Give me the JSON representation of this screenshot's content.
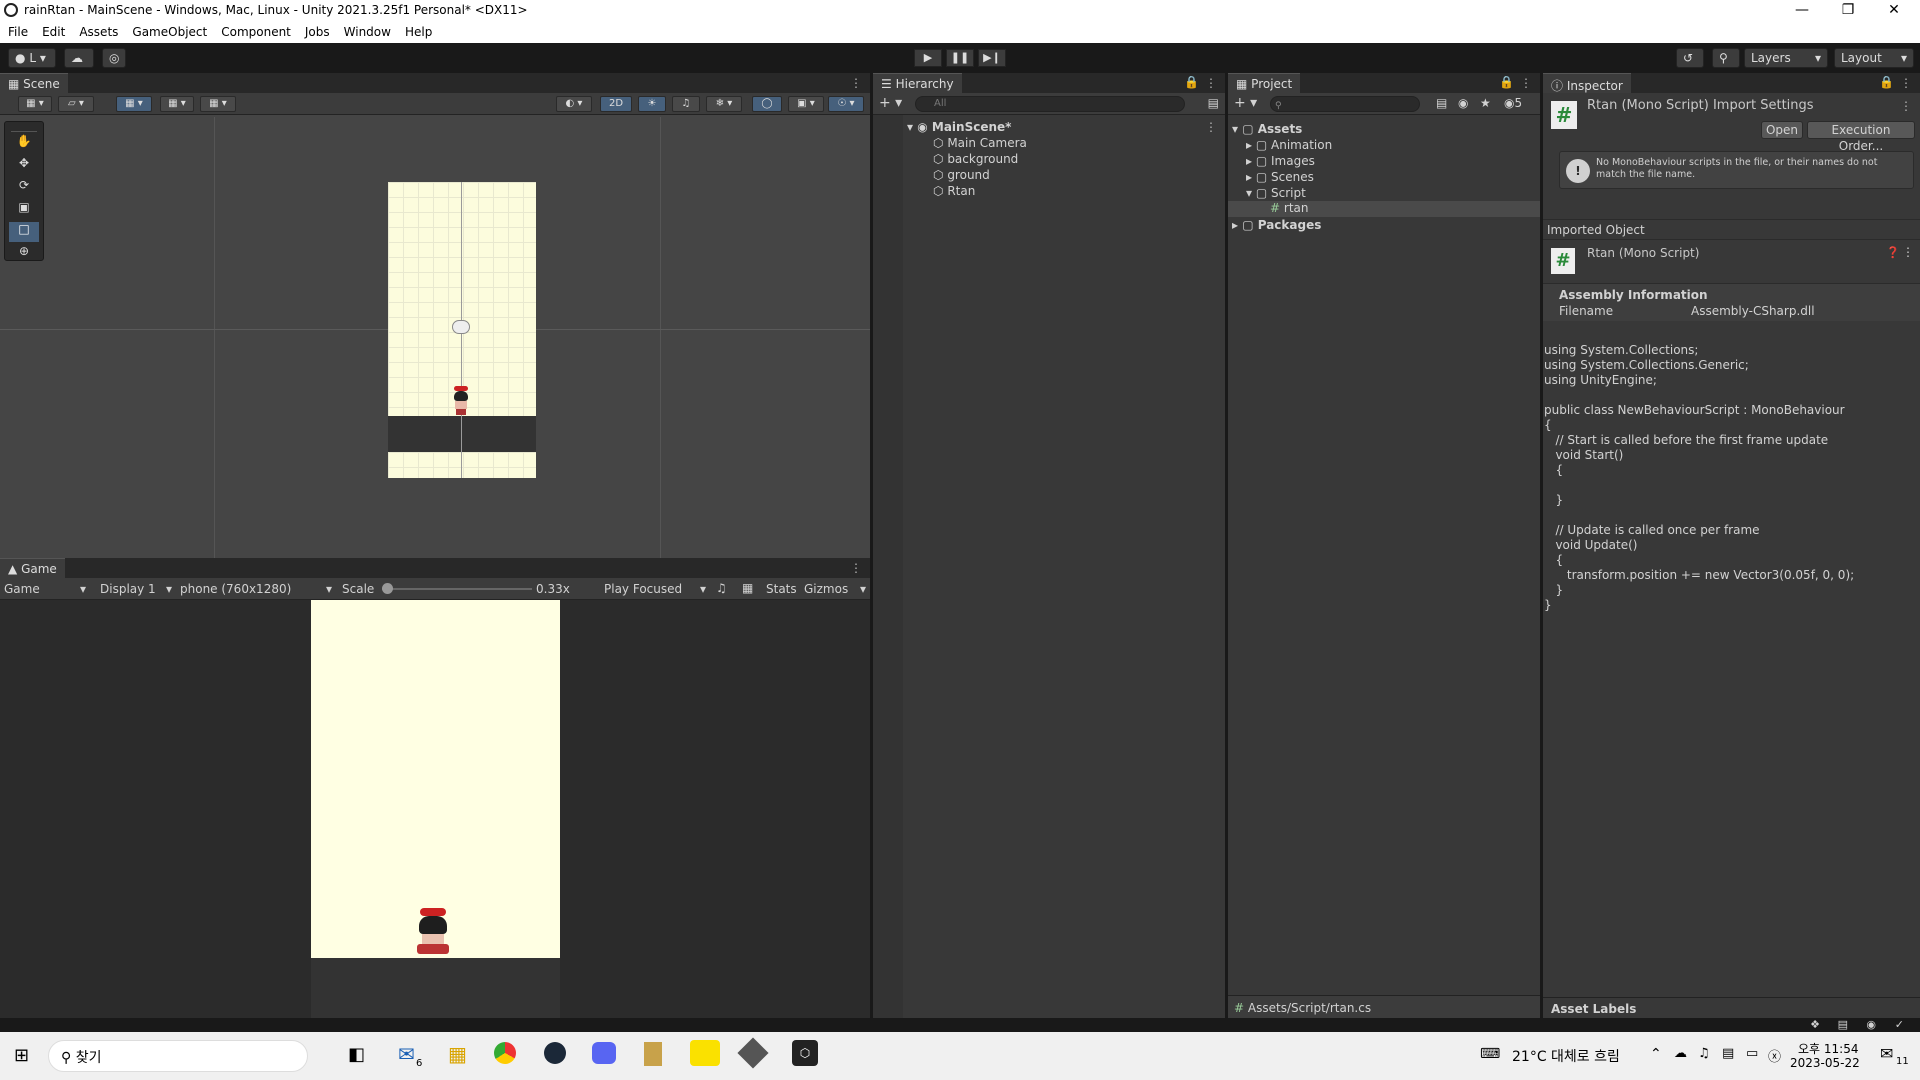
{
  "window": {
    "title": "rainRtan - MainScene - Windows, Mac, Linux - Unity 2021.3.25f1 Personal* <DX11>"
  },
  "menu": [
    "File",
    "Edit",
    "Assets",
    "GameObject",
    "Component",
    "Jobs",
    "Window",
    "Help"
  ],
  "toolbar": {
    "account": "L",
    "layers": "Layers",
    "layout": "Layout"
  },
  "scene": {
    "tab": "Scene",
    "mode_2d": "2D"
  },
  "game": {
    "tab": "Game",
    "view": "Game",
    "display": "Display 1",
    "resolution": "phone (760x1280)",
    "scale_label": "Scale",
    "scale_value": "0.33x",
    "play_mode": "Play Focused",
    "stats": "Stats",
    "gizmos": "Gizmos"
  },
  "hierarchy": {
    "tab": "Hierarchy",
    "search_placeholder": "All",
    "scene": "MainScene*",
    "items": [
      "Main Camera",
      "background",
      "ground",
      "Rtan"
    ]
  },
  "project": {
    "tab": "Project",
    "visible_count": "5",
    "assets": "Assets",
    "folders": [
      "Animation",
      "Images",
      "Scenes",
      "Script"
    ],
    "script_file": "rtan",
    "packages": "Packages",
    "path": "Assets/Script/rtan.cs"
  },
  "inspector": {
    "tab": "Inspector",
    "title": "Rtan (Mono Script) Import Settings",
    "open": "Open",
    "execution_order": "Execution Order...",
    "warning": "No MonoBehaviour scripts in the file, or their names do not match the file name.",
    "imported_object": "Imported Object",
    "object_name": "Rtan (Mono Script)",
    "assembly_info": "Assembly Information",
    "filename_label": "Filename",
    "filename_value": "Assembly-CSharp.dll",
    "code": "using System.Collections;\nusing System.Collections.Generic;\nusing UnityEngine;\n\npublic class NewBehaviourScript : MonoBehaviour\n{\n   // Start is called before the first frame update\n   void Start()\n   {\n\n   }\n\n   // Update is called once per frame\n   void Update()\n   {\n      transform.position += new Vector3(0.05f, 0, 0);\n   }\n}",
    "asset_labels": "Asset Labels"
  },
  "taskbar": {
    "search": "찾기",
    "mail_badge": "6",
    "weather": "21°C 대체로 흐림",
    "time": "오후 11:54",
    "date": "2023-05-22",
    "notif": "11"
  },
  "colors": {
    "accent": "#46607c",
    "panel": "#383838",
    "dark": "#191919",
    "game_bg": "#ffffe3"
  }
}
